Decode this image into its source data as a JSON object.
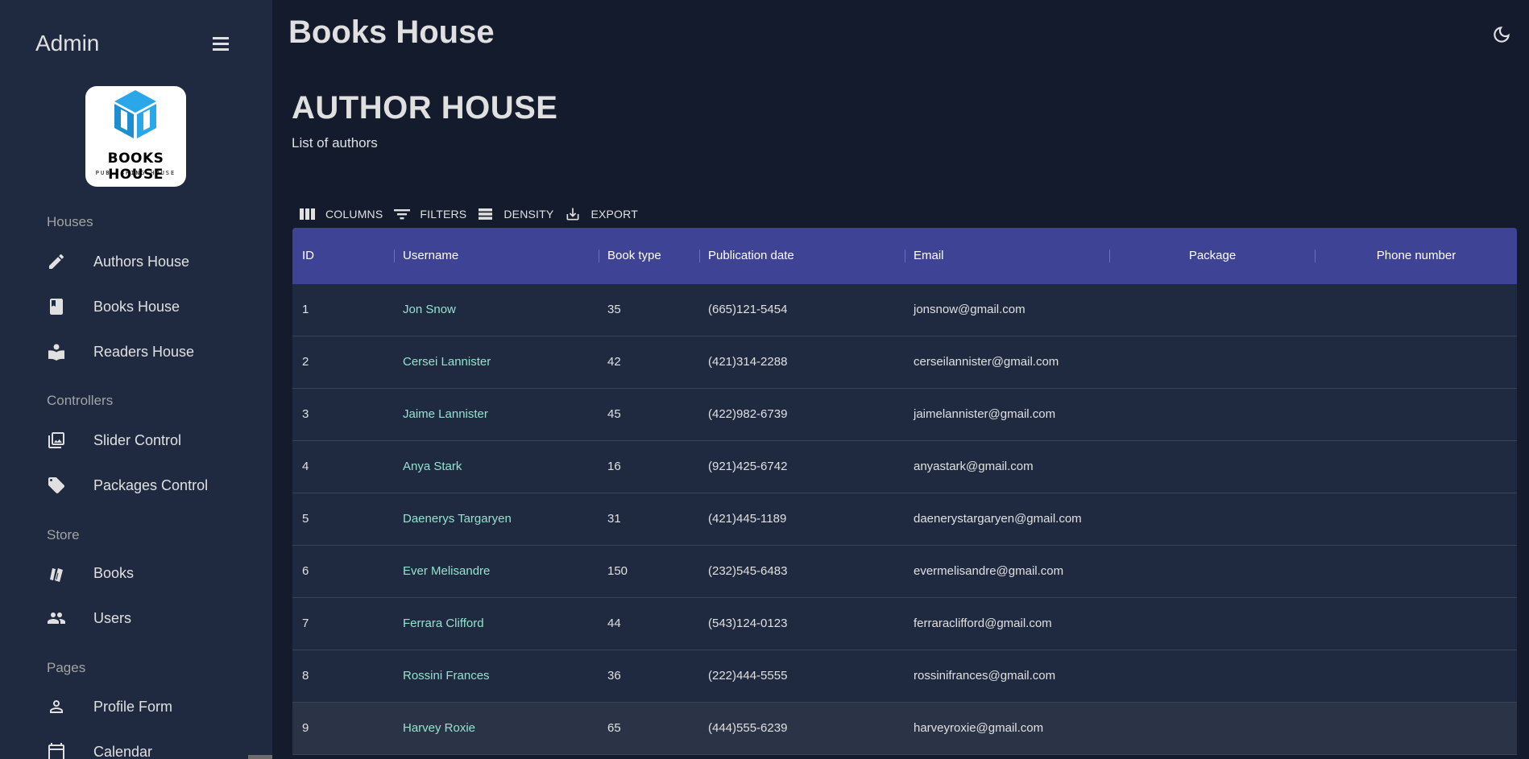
{
  "sidebar": {
    "title": "Admin",
    "logo": {
      "text": "BOOKS HOUSE",
      "subtext": "PUBLISHING HOUSE"
    },
    "sections": [
      {
        "label": "Houses",
        "items": [
          {
            "label": "Authors House",
            "icon": "pencil-icon"
          },
          {
            "label": "Books House",
            "icon": "book-icon"
          },
          {
            "label": "Readers House",
            "icon": "reader-icon"
          }
        ]
      },
      {
        "label": "Controllers",
        "items": [
          {
            "label": "Slider Control",
            "icon": "image-collection-icon"
          },
          {
            "label": "Packages Control",
            "icon": "tag-icon"
          }
        ]
      },
      {
        "label": "Store",
        "items": [
          {
            "label": "Books",
            "icon": "books-icon"
          },
          {
            "label": "Users",
            "icon": "users-icon"
          }
        ]
      },
      {
        "label": "Pages",
        "items": [
          {
            "label": "Profile Form",
            "icon": "person-icon"
          },
          {
            "label": "Calendar",
            "icon": "calendar-icon"
          }
        ]
      }
    ]
  },
  "topbar": {
    "title": "Books House",
    "theme_icon": "moon-icon"
  },
  "page": {
    "title": "AUTHOR HOUSE",
    "subtitle": "List of authors"
  },
  "toolbar": {
    "columns": "COLUMNS",
    "filters": "FILTERS",
    "density": "DENSITY",
    "export": "EXPORT"
  },
  "table": {
    "columns": [
      "ID",
      "Username",
      "Book type",
      "Publication date",
      "Email",
      "Package",
      "Phone number"
    ],
    "rows": [
      {
        "id": "1",
        "username": "Jon Snow",
        "book_type": "35",
        "publication_date": "(665)121-5454",
        "email": "jonsnow@gmail.com"
      },
      {
        "id": "2",
        "username": "Cersei Lannister",
        "book_type": "42",
        "publication_date": "(421)314-2288",
        "email": "cerseilannister@gmail.com"
      },
      {
        "id": "3",
        "username": "Jaime Lannister",
        "book_type": "45",
        "publication_date": "(422)982-6739",
        "email": "jaimelannister@gmail.com"
      },
      {
        "id": "4",
        "username": "Anya Stark",
        "book_type": "16",
        "publication_date": "(921)425-6742",
        "email": "anyastark@gmail.com"
      },
      {
        "id": "5",
        "username": "Daenerys Targaryen",
        "book_type": "31",
        "publication_date": "(421)445-1189",
        "email": "daenerystargaryen@gmail.com"
      },
      {
        "id": "6",
        "username": "Ever Melisandre",
        "book_type": "150",
        "publication_date": "(232)545-6483",
        "email": "evermelisandre@gmail.com"
      },
      {
        "id": "7",
        "username": "Ferrara Clifford",
        "book_type": "44",
        "publication_date": "(543)124-0123",
        "email": "ferraraclifford@gmail.com"
      },
      {
        "id": "8",
        "username": "Rossini Frances",
        "book_type": "36",
        "publication_date": "(222)444-5555",
        "email": "rossinifrances@gmail.com"
      },
      {
        "id": "9",
        "username": "Harvey Roxie",
        "book_type": "65",
        "publication_date": "(444)555-6239",
        "email": "harveyroxie@gmail.com"
      }
    ]
  },
  "colors": {
    "background": "#141b2d",
    "sidebar": "#1f2a40",
    "header": "#3e4396",
    "accent": "#94e2cd"
  }
}
